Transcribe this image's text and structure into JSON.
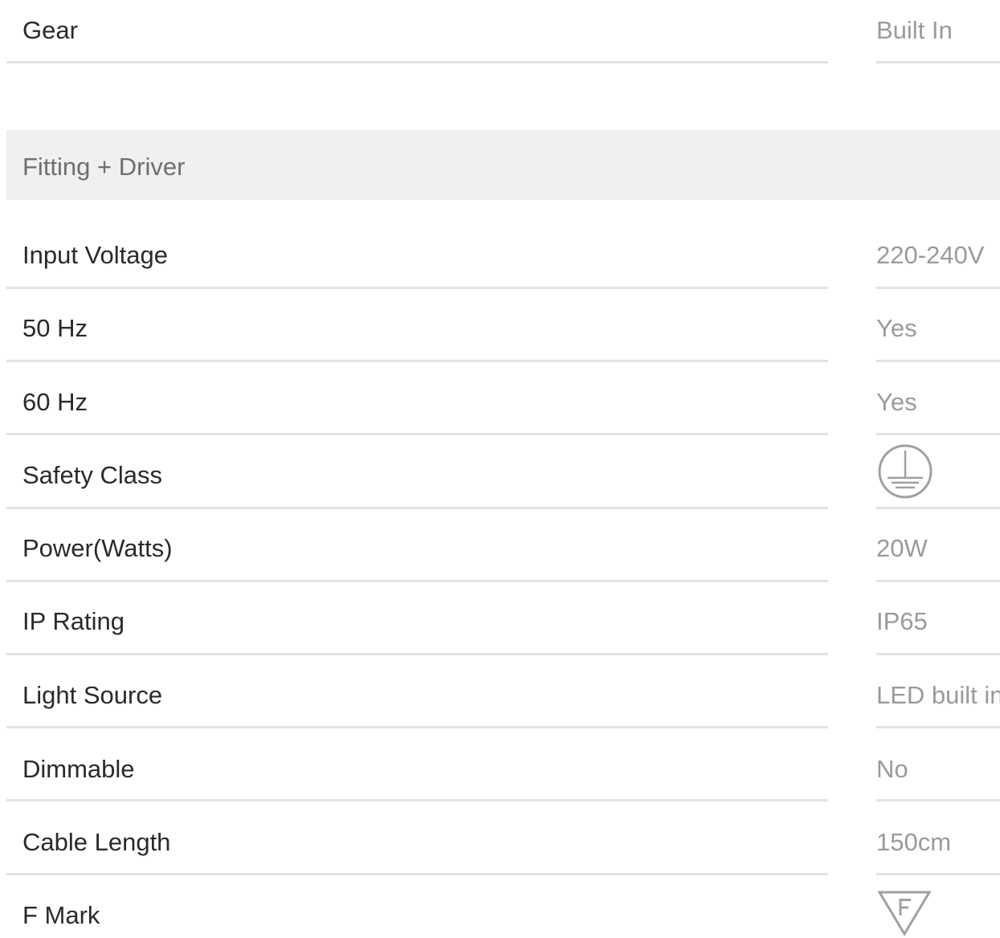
{
  "gear": {
    "label": "Gear",
    "value": "Built In"
  },
  "section": {
    "title": "Fitting + Driver"
  },
  "rows": [
    {
      "label": "Input Voltage",
      "value": "220-240V"
    },
    {
      "label": "50 Hz",
      "value": "Yes"
    },
    {
      "label": "60 Hz",
      "value": "Yes"
    },
    {
      "label": "Safety Class",
      "icon": "earth-ground-class-i-icon"
    },
    {
      "label": "Power(Watts)",
      "value": "20W"
    },
    {
      "label": "IP Rating",
      "value": "IP65"
    },
    {
      "label": "Light Source",
      "value": "LED built in"
    },
    {
      "label": "Dimmable",
      "value": "No"
    },
    {
      "label": "Cable Length",
      "value": "150cm"
    },
    {
      "label": "F Mark",
      "icon": "f-mark-triangle-icon"
    }
  ],
  "colors": {
    "label_text": "#2a2a2a",
    "value_text": "#9a9a9a",
    "section_text": "#6f6f6f",
    "section_background": "#f0f0f0",
    "divider": "#e3e3e3",
    "icon_stroke": "#a0a0a0"
  }
}
